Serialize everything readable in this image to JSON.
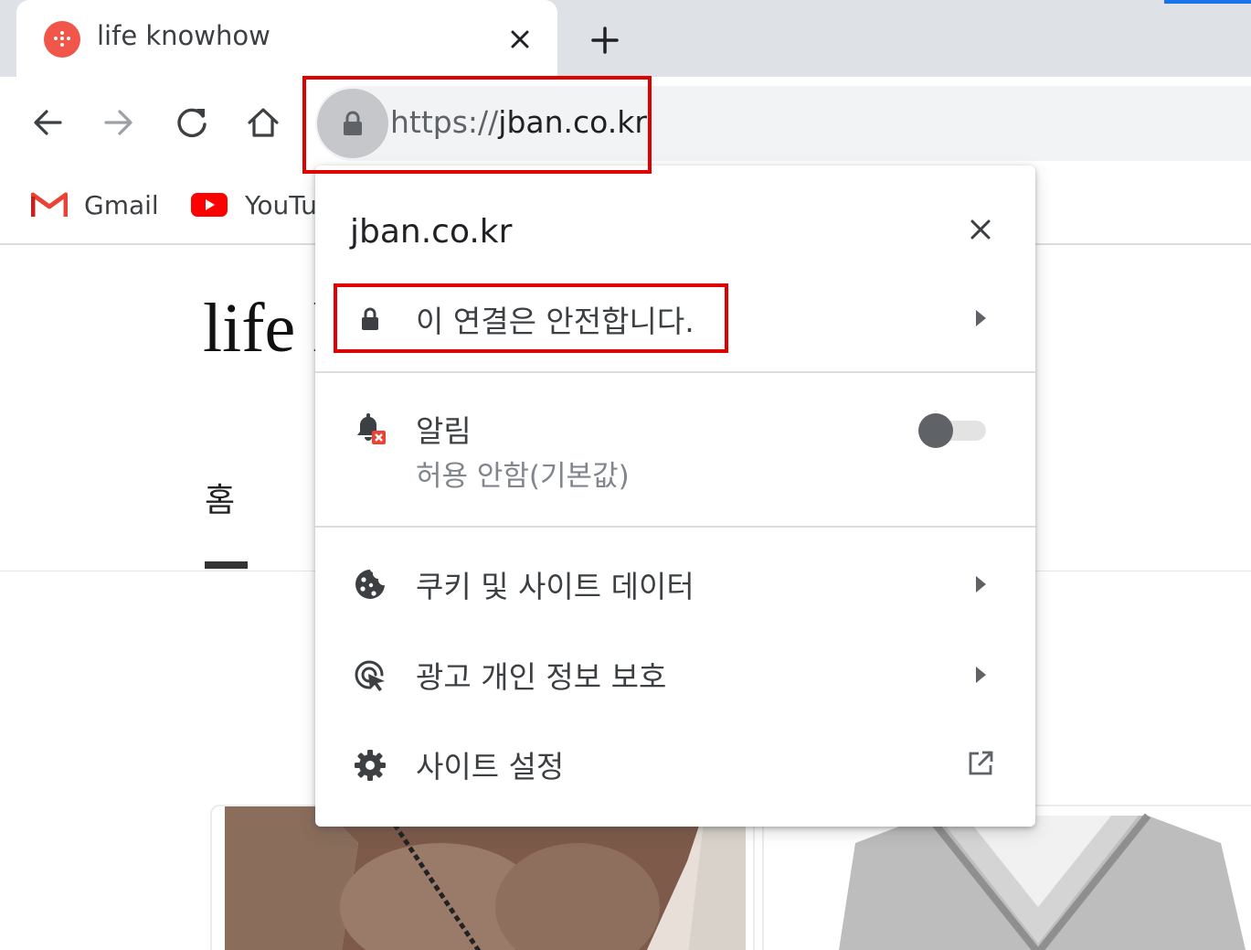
{
  "tab": {
    "title": "life knowhow",
    "favicon": "dots-icon",
    "favicon_color": "#f0564a"
  },
  "toolbar": {
    "back": "arrow-left-icon",
    "forward": "arrow-right-icon",
    "reload": "reload-icon",
    "home": "home-icon",
    "url_scheme": "https://",
    "url_host": "jban.co.kr"
  },
  "bookmarks": [
    {
      "label": "Gmail",
      "icon": "gmail-icon"
    },
    {
      "label": "YouTu",
      "icon": "youtube-icon"
    }
  ],
  "page": {
    "title_visible": "life l",
    "home_tab": "홈"
  },
  "popup": {
    "host": "jban.co.kr",
    "connection": "이 연결은 안전합니다.",
    "notifications": {
      "label": "알림",
      "status": "허용 안함(기본값)",
      "enabled": false
    },
    "cookies": "쿠키 및 사이트 데이터",
    "ad_privacy": "광고 개인 정보 보호",
    "site_settings": "사이트 설정"
  },
  "colors": {
    "highlight": "#e10000",
    "accent": "#1a73e8",
    "toolbar_bg": "#dee1e6"
  }
}
